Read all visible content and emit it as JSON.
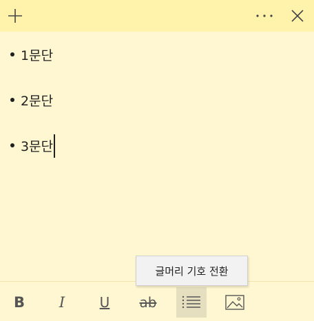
{
  "titlebar": {
    "add_icon": "plus-icon",
    "more_icon": "ellipsis-icon",
    "close_icon": "close-icon"
  },
  "note": {
    "paragraphs": [
      {
        "text": "1문단"
      },
      {
        "text": "2문단"
      },
      {
        "text": "3문단"
      }
    ]
  },
  "tooltip": {
    "text": "글머리 기호 전환"
  },
  "toolbar": {
    "bold_label": "B",
    "italic_label": "I",
    "underline_label": "U",
    "strike_label": "ab",
    "bullets_icon": "bulleted-list-icon",
    "image_icon": "image-icon"
  },
  "colors": {
    "titlebar_bg": "#fff2ab",
    "note_bg": "#fff7d1",
    "active_button_bg": "#e6dfbf",
    "text": "#1f1f1f"
  }
}
